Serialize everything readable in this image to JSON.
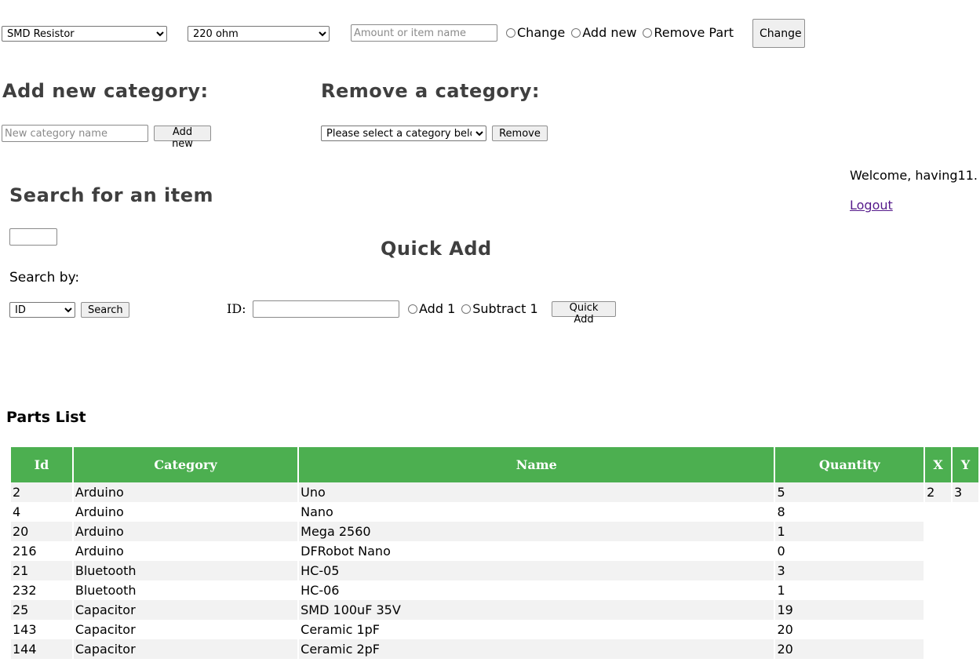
{
  "top_form": {
    "category_select": {
      "selected": "SMD Resistor"
    },
    "part_select": {
      "selected": "220 ohm"
    },
    "amount_input": {
      "placeholder": "Amount or item name"
    },
    "radios": {
      "change": "Change",
      "add_new": "Add new",
      "remove_part": "Remove Part"
    },
    "submit_label": "Change"
  },
  "add_category": {
    "title": "Add new category:",
    "input_placeholder": "New category name",
    "button_label": "Add new"
  },
  "remove_category": {
    "title": "Remove a category:",
    "select_selected": "Please select a category below",
    "button_label": "Remove"
  },
  "user": {
    "welcome": "Welcome, having11.",
    "logout": "Logout"
  },
  "search": {
    "title": "Search for an item",
    "search_by_label": "Search by:",
    "search_by_selected": "ID",
    "button_label": "Search"
  },
  "quick_add": {
    "title": "Quick Add",
    "id_label": "ID:",
    "radios": {
      "add": "Add 1",
      "subtract": "Subtract 1"
    },
    "button_label": "Quick Add"
  },
  "parts_list": {
    "title": "Parts List",
    "columns": [
      "Id",
      "Category",
      "Name",
      "Quantity",
      "X",
      "Y"
    ],
    "rows": [
      {
        "id": "2",
        "category": "Arduino",
        "name": "Uno",
        "quantity": "5",
        "x": "2",
        "y": "3"
      },
      {
        "id": "4",
        "category": "Arduino",
        "name": "Nano",
        "quantity": "8",
        "x": "",
        "y": ""
      },
      {
        "id": "20",
        "category": "Arduino",
        "name": "Mega 2560",
        "quantity": "1",
        "x": "",
        "y": ""
      },
      {
        "id": "216",
        "category": "Arduino",
        "name": "DFRobot Nano",
        "quantity": "0",
        "x": "",
        "y": ""
      },
      {
        "id": "21",
        "category": "Bluetooth",
        "name": "HC-05",
        "quantity": "3",
        "x": "",
        "y": ""
      },
      {
        "id": "232",
        "category": "Bluetooth",
        "name": "HC-06",
        "quantity": "1",
        "x": "",
        "y": ""
      },
      {
        "id": "25",
        "category": "Capacitor",
        "name": "SMD 100uF 35V",
        "quantity": "19",
        "x": "",
        "y": ""
      },
      {
        "id": "143",
        "category": "Capacitor",
        "name": "Ceramic 1pF",
        "quantity": "20",
        "x": "",
        "y": ""
      },
      {
        "id": "144",
        "category": "Capacitor",
        "name": "Ceramic 2pF",
        "quantity": "20",
        "x": "",
        "y": ""
      }
    ]
  },
  "colors": {
    "header_bg": "#4caf50",
    "heading_text": "#3f3f3f",
    "row_stripe": "#f2f2f2"
  }
}
